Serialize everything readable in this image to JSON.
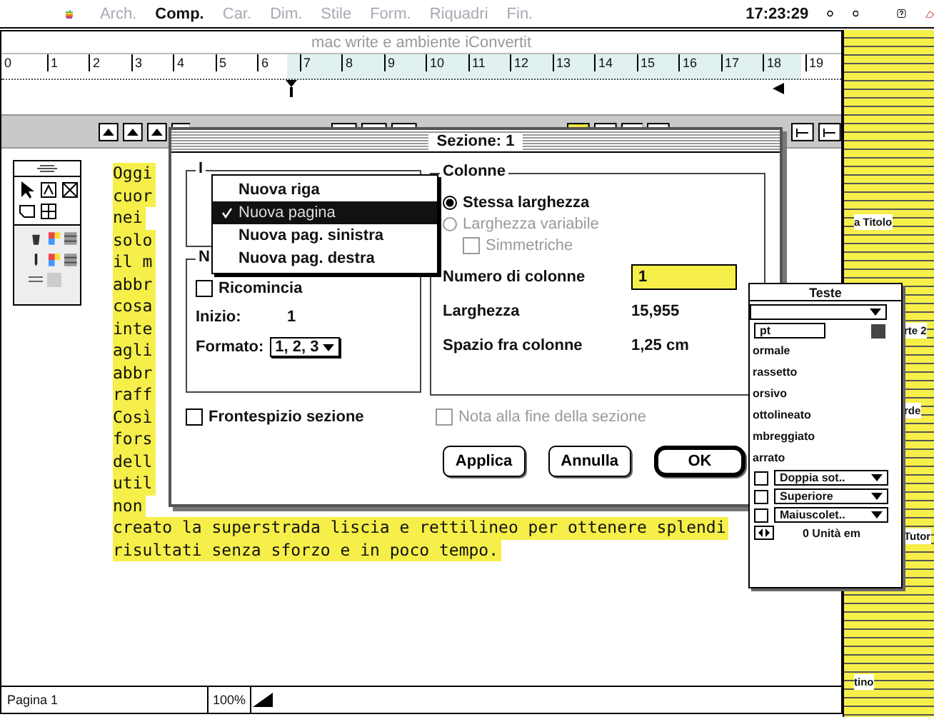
{
  "menu_bar": {
    "items": [
      {
        "label": "Arch.",
        "disabled": true
      },
      {
        "label": "Comp.",
        "disabled": false
      },
      {
        "label": "Car.",
        "disabled": true
      },
      {
        "label": "Dim.",
        "disabled": true
      },
      {
        "label": "Stile",
        "disabled": true
      },
      {
        "label": "Form.",
        "disabled": true
      },
      {
        "label": "Riquadri",
        "disabled": true
      },
      {
        "label": "Fin.",
        "disabled": true
      }
    ],
    "clock": "17:23:29"
  },
  "document": {
    "title": "mac write e ambiente iConvertit",
    "ruler": [
      "0",
      "1",
      "2",
      "3",
      "4",
      "5",
      "6",
      "7",
      "8",
      "9",
      "10",
      "11",
      "12",
      "13",
      "14",
      "15",
      "16",
      "17",
      "18",
      "19"
    ],
    "lines": [
      "Oggi",
      "cuor",
      "nei",
      "solo",
      "il m",
      "abbr",
      "cosa",
      "inte",
      "agli",
      "abbr",
      "raff",
      "Così",
      "fors",
      "dell",
      "util",
      "non",
      "creato la superstrada liscia e rettilineo per ottenere splendi",
      "risultati senza sforzo e in poco tempo."
    ],
    "status": {
      "page": "Pagina 1",
      "zoom": "100%"
    }
  },
  "dialog": {
    "title": "Sezione: 1",
    "start_legend": "I",
    "numbering": {
      "legend": "N",
      "restart": {
        "label": "Ricomincia",
        "checked": false
      },
      "start_label": "Inizio:",
      "start_value": "1",
      "format_label": "Formato:",
      "format_value": "1, 2, 3"
    },
    "columns": {
      "legend": "Colonne",
      "options": [
        {
          "label": "Stessa larghezza",
          "selected": true,
          "disabled": false
        },
        {
          "label": "Larghezza variabile",
          "selected": false,
          "disabled": true
        }
      ],
      "symmetric": {
        "label": "Simmetriche",
        "checked": false,
        "disabled": true
      },
      "fields": [
        {
          "label": "Numero di colonne",
          "value": "1",
          "kind": "input"
        },
        {
          "label": "Larghezza",
          "value": "15,955",
          "kind": "text"
        },
        {
          "label": "Spazio fra colonne",
          "value": "1,25 cm",
          "kind": "text"
        }
      ]
    },
    "options": [
      {
        "label": "Frontespizio sezione",
        "checked": false,
        "disabled": false
      },
      {
        "label": "Nota alla fine della sezione",
        "checked": false,
        "disabled": true
      }
    ],
    "buttons": [
      {
        "label": "Applica",
        "default": false
      },
      {
        "label": "Annulla",
        "default": false
      },
      {
        "label": "OK",
        "default": true
      }
    ]
  },
  "popup_menu": {
    "items": [
      {
        "label": "Nuova riga",
        "selected": false
      },
      {
        "label": "Nuova pagina",
        "selected": true
      },
      {
        "label": "Nuova pag. sinistra",
        "selected": false
      },
      {
        "label": "Nuova pag. destra",
        "selected": false
      }
    ]
  },
  "styles_palette": {
    "title": "Teste",
    "size": "pt",
    "styles": [
      "ormale",
      "rassetto",
      "orsivo",
      "ottolineato",
      "mbreggiato",
      "arrato"
    ],
    "dropdowns": [
      {
        "label": "Doppia sot..",
        "checked": false
      },
      {
        "label": "Superiore",
        "checked": false
      },
      {
        "label": "Maiuscolet..",
        "checked": false
      }
    ],
    "spacing": "0 Unità em"
  },
  "desktop_labels": [
    "a Titolo",
    "rte 2",
    "rde",
    "Tutor",
    "tino"
  ]
}
